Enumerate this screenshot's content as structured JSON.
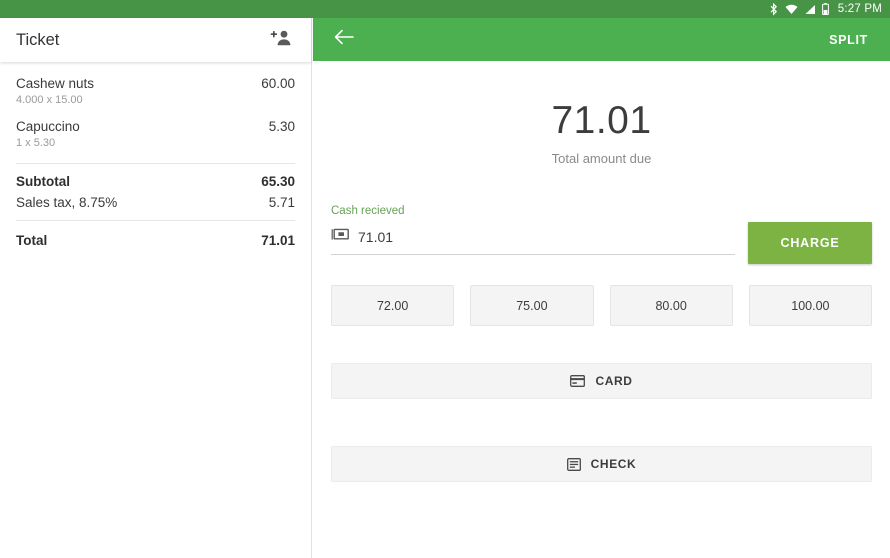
{
  "statusbar": {
    "time": "5:27 PM",
    "icons": [
      "bluetooth-icon",
      "wifi-icon",
      "signal-icon",
      "battery-icon"
    ]
  },
  "ticket": {
    "title": "Ticket",
    "add_person_icon": "person-add-icon",
    "items": [
      {
        "name": "Cashew nuts",
        "qty_line": "4.000 x 15.00",
        "price": "60.00"
      },
      {
        "name": "Capuccino",
        "qty_line": "1 x 5.30",
        "price": "5.30"
      }
    ],
    "totals": [
      {
        "label": "Subtotal",
        "value": "65.30"
      },
      {
        "label": "Sales tax, 8.75%",
        "value": "5.71"
      }
    ],
    "grand_total": {
      "label": "Total",
      "value": "71.01"
    }
  },
  "payment": {
    "back_icon": "arrow-back-icon",
    "split_label": "SPLIT",
    "amount_due": "71.01",
    "amount_caption": "Total amount due",
    "cash_label": "Cash recieved",
    "cash_icon": "money-icon",
    "cash_value": "71.01",
    "charge_label": "CHARGE",
    "quick_amounts": [
      "72.00",
      "75.00",
      "80.00",
      "100.00"
    ],
    "card": {
      "label": "CARD",
      "icon": "credit-card-icon"
    },
    "check": {
      "label": "CHECK",
      "icon": "receipt-icon"
    }
  },
  "colors": {
    "statusbar_green": "#479447",
    "appbar_green": "#4CAF50",
    "charge_green": "#7CB342",
    "cash_label_green": "#66a355",
    "button_grey": "#f4f4f4"
  }
}
